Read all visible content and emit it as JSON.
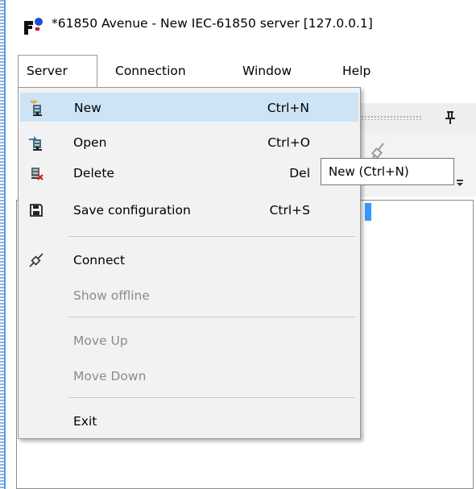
{
  "window": {
    "title": "*61850 Avenue - New IEC-61850 server [127.0.0.1]",
    "app_icon": "app-logo-icon"
  },
  "menubar": {
    "items": [
      {
        "label": "Server",
        "open": true
      },
      {
        "label": "Connection"
      },
      {
        "label": "Window"
      },
      {
        "label": "Help"
      }
    ]
  },
  "server_menu": {
    "items": [
      {
        "label": "New",
        "shortcut": "Ctrl+N",
        "icon": "new-server-icon",
        "highlighted": true
      },
      {
        "label": "Open",
        "shortcut": "Ctrl+O",
        "icon": "open-server-icon"
      },
      {
        "label": "Delete",
        "shortcut": "Del",
        "icon": "delete-server-icon"
      },
      {
        "label": "Save configuration",
        "shortcut": "Ctrl+S",
        "icon": "save-icon"
      },
      {
        "label": "Connect",
        "icon": "plug-icon"
      },
      {
        "label": "Show offline",
        "disabled": true
      },
      {
        "label": "Move Up",
        "disabled": true
      },
      {
        "label": "Move Down",
        "disabled": true
      },
      {
        "label": "Exit"
      }
    ]
  },
  "tooltip": {
    "text": "New (Ctrl+N)"
  },
  "colors": {
    "highlight": "#cde4f7",
    "menu_background": "#f2f2f2",
    "disabled_text": "#8a8a8a",
    "selection": "#3399ff"
  }
}
